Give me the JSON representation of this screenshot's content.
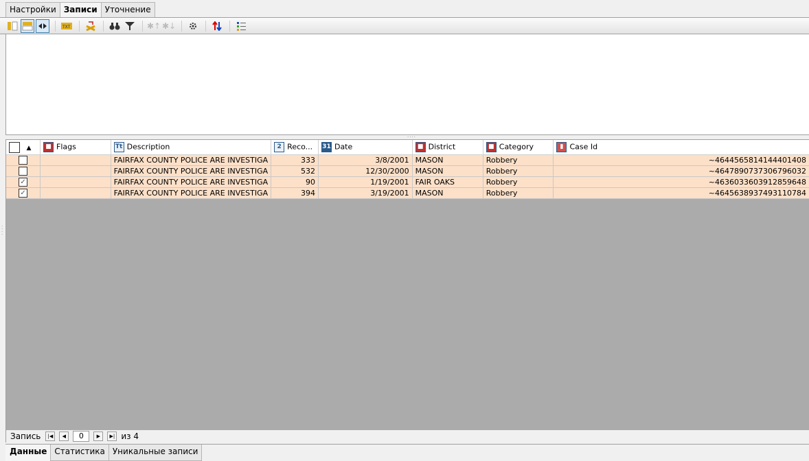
{
  "top_tabs": [
    {
      "label": "Настройки",
      "active": false
    },
    {
      "label": "Записи",
      "active": true
    },
    {
      "label": "Уточнение",
      "active": false
    }
  ],
  "toolbar": {
    "icons": [
      "columns-icon",
      "grid-view-icon",
      "expand-columns-icon",
      "txt-export-icon",
      "clear-sort-icon",
      "find-icon",
      "filter-icon",
      "prev-marked-icon",
      "next-marked-icon",
      "settings-icon",
      "sort-icon",
      "list-icon"
    ]
  },
  "grid": {
    "columns": [
      {
        "label": "",
        "icon": "select-all-checkbox"
      },
      {
        "label": "Flags",
        "icon": "category-icon"
      },
      {
        "label": "Description",
        "icon": "text-icon"
      },
      {
        "label": "Reco...",
        "icon": "number-icon"
      },
      {
        "label": "Date",
        "icon": "calendar-icon"
      },
      {
        "label": "District",
        "icon": "category-icon"
      },
      {
        "label": "Category",
        "icon": "category-icon"
      },
      {
        "label": "Case Id",
        "icon": "id-icon"
      }
    ],
    "rows": [
      {
        "checked": false,
        "flags": "",
        "description": "FAIRFAX COUNTY POLICE ARE INVESTIGA",
        "record": "333",
        "date": "3/8/2001",
        "district": "MASON",
        "category": "Robbery",
        "case_id": "~4644565814144401408"
      },
      {
        "checked": false,
        "flags": "",
        "description": "FAIRFAX COUNTY POLICE ARE INVESTIGA",
        "record": "532",
        "date": "12/30/2000",
        "district": "MASON",
        "category": "Robbery",
        "case_id": "~4647890737306796032"
      },
      {
        "checked": true,
        "flags": "",
        "description": "FAIRFAX COUNTY POLICE ARE INVESTIGA",
        "record": "90",
        "date": "1/19/2001",
        "district": "FAIR OAKS",
        "category": "Robbery",
        "case_id": "~4636033603912859648"
      },
      {
        "checked": true,
        "flags": "",
        "description": "FAIRFAX COUNTY POLICE ARE INVESTIGA",
        "record": "394",
        "date": "3/19/2001",
        "district": "MASON",
        "category": "Robbery",
        "case_id": "~4645638937493110784"
      }
    ]
  },
  "navigator": {
    "label": "Запись",
    "current": "0",
    "of_label": "из 4"
  },
  "bottom_tabs": [
    {
      "label": "Данные",
      "active": true
    },
    {
      "label": "Статистика",
      "active": false
    },
    {
      "label": "Уникальные записи",
      "active": false
    }
  ],
  "colors": {
    "row_bg": "#fce0c8",
    "empty_grid": "#ababab"
  }
}
